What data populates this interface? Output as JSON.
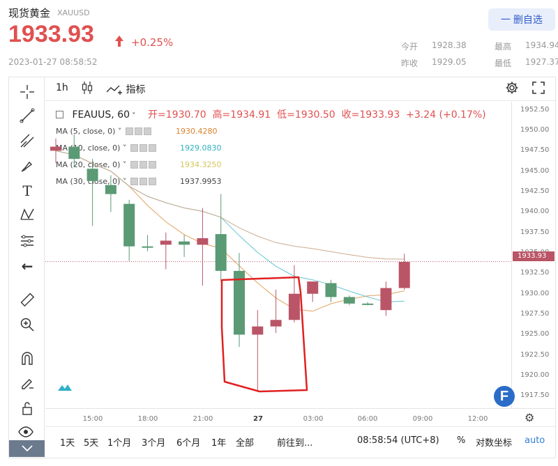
{
  "header": {
    "title": "现货黄金",
    "symbol": "XAUUSD",
    "price": "1933.93",
    "change": "+0.25%",
    "timestamp": "2023-01-27 08:58:52",
    "watch_button": "一 删自选",
    "stats": [
      {
        "label": "今开",
        "value": "1928.38"
      },
      {
        "label": "最高",
        "value": "1934.94"
      },
      {
        "label": "昨收",
        "value": "1929.05"
      },
      {
        "label": "最低",
        "value": "1927.37"
      }
    ]
  },
  "toolbar": {
    "interval": "1h",
    "indicators_label": "指标"
  },
  "legend": {
    "symbol_interval": "FEAUUS, 60",
    "open_label": "开=1930.70",
    "high_label": "高=1934.91",
    "low_label": "低=1930.50",
    "close_label": "收=1933.93",
    "change_text": "+3.24 (+0.17%)"
  },
  "ma": [
    {
      "label": "MA (5, close, 0)",
      "value": "1930.4280",
      "color": "#d9822b"
    },
    {
      "label": "MA (10, close, 0)",
      "value": "1929.0830",
      "color": "#2fb0c0"
    },
    {
      "label": "MA (20, close, 0)",
      "value": "1934.3250",
      "color": "#d4c65a"
    },
    {
      "label": "MA (30, close, 0)",
      "value": "1937.9953",
      "color": "#555555"
    }
  ],
  "yaxis_labels": [
    "1952.50",
    "1950.00",
    "1947.50",
    "1945.00",
    "1942.50",
    "1940.00",
    "1937.50",
    "1935.00",
    "1932.50",
    "1930.00",
    "1927.50",
    "1925.00",
    "1922.50",
    "1920.00",
    "1917.50"
  ],
  "current_price_tag": "1933.93",
  "xaxis_labels": [
    "15:00",
    "18:00",
    "21:00",
    "27",
    "03:00",
    "06:00",
    "09:00",
    "12:00"
  ],
  "bottom_bar": {
    "ranges": [
      "1天",
      "5天",
      "1个月",
      "3个月",
      "6个月",
      "1年",
      "全部"
    ],
    "goto": "前往到...",
    "clock": "08:58:54 (UTC+8)",
    "percent": "%",
    "log": "对数坐标",
    "auto": "auto"
  },
  "colors": {
    "up": "#b95566",
    "down": "#5a9a74",
    "annotation": "#e02020"
  },
  "chart_data": {
    "type": "candlestick",
    "interval": "60",
    "ylim": [
      1916.0,
      1953.5
    ],
    "candles": [
      {
        "o": 1948.0,
        "h": 1949.0,
        "l": 1946.0,
        "c": 1947.5,
        "dir": "up"
      },
      {
        "o": 1948.0,
        "h": 1949.5,
        "l": 1945.5,
        "c": 1946.5,
        "dir": "down"
      },
      {
        "o": 1945.3,
        "h": 1946.5,
        "l": 1938.3,
        "c": 1943.8,
        "dir": "down"
      },
      {
        "o": 1943.3,
        "h": 1944.5,
        "l": 1940.0,
        "c": 1942.2,
        "dir": "down"
      },
      {
        "o": 1941.0,
        "h": 1941.5,
        "l": 1934.0,
        "c": 1935.8,
        "dir": "down"
      },
      {
        "o": 1935.8,
        "h": 1937.2,
        "l": 1935.2,
        "c": 1935.7,
        "dir": "down"
      },
      {
        "o": 1936.0,
        "h": 1937.5,
        "l": 1933.0,
        "c": 1936.5,
        "dir": "up"
      },
      {
        "o": 1936.4,
        "h": 1937.2,
        "l": 1934.5,
        "c": 1936.0,
        "dir": "down"
      },
      {
        "o": 1936.0,
        "h": 1940.5,
        "l": 1931.0,
        "c": 1936.8,
        "dir": "up"
      },
      {
        "o": 1937.3,
        "h": 1942.2,
        "l": 1931.5,
        "c": 1932.8,
        "dir": "down"
      },
      {
        "o": 1932.8,
        "h": 1935.0,
        "l": 1923.5,
        "c": 1925.0,
        "dir": "down"
      },
      {
        "o": 1925.0,
        "h": 1928.0,
        "l": 1918.0,
        "c": 1926.0,
        "dir": "up"
      },
      {
        "o": 1926.0,
        "h": 1930.5,
        "l": 1925.2,
        "c": 1926.8,
        "dir": "up"
      },
      {
        "o": 1926.8,
        "h": 1933.5,
        "l": 1926.5,
        "c": 1930.0,
        "dir": "up"
      },
      {
        "o": 1930.0,
        "h": 1931.5,
        "l": 1929.0,
        "c": 1931.5,
        "dir": "up"
      },
      {
        "o": 1931.3,
        "h": 1931.7,
        "l": 1929.0,
        "c": 1929.6,
        "dir": "down"
      },
      {
        "o": 1929.6,
        "h": 1929.8,
        "l": 1928.6,
        "c": 1928.8,
        "dir": "down"
      },
      {
        "o": 1928.8,
        "h": 1929.0,
        "l": 1928.6,
        "c": 1928.8,
        "dir": "down"
      },
      {
        "o": 1928.0,
        "h": 1931.5,
        "l": 1927.3,
        "c": 1930.7,
        "dir": "up"
      },
      {
        "o": 1930.7,
        "h": 1934.9,
        "l": 1930.5,
        "c": 1933.9,
        "dir": "up"
      }
    ]
  }
}
